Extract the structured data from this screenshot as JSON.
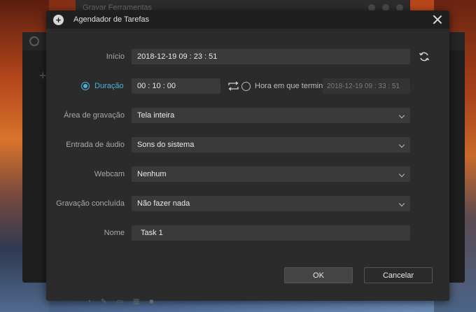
{
  "background": {
    "top_window_title": "Gravar  Ferramentas"
  },
  "dialog": {
    "title": "Agendador de Tarefas",
    "start": {
      "label": "Início",
      "value": "2018-12-19 09 : 23 : 51"
    },
    "duration": {
      "label": "Duração",
      "value": "00 : 10 : 00",
      "selected": true
    },
    "end_time": {
      "label": "Hora em que termina",
      "value": "2018-12-19 09 : 33 : 51",
      "selected": false
    },
    "record_area": {
      "label": "Área de gravação",
      "value": "Tela inteira"
    },
    "audio_input": {
      "label": "Entrada de áudio",
      "value": "Sons do sistema"
    },
    "webcam": {
      "label": "Webcam",
      "value": "Nenhum"
    },
    "recording_done": {
      "label": "Gravação concluída",
      "value": "Não fazer nada"
    },
    "name": {
      "label": "Nome",
      "value": "Task 1"
    },
    "ok_label": "OK",
    "cancel_label": "Cancelar"
  },
  "colors": {
    "accent": "#4ab2d8",
    "dialog_bg": "#2b2b2b",
    "field_bg": "#3a3a3a"
  }
}
